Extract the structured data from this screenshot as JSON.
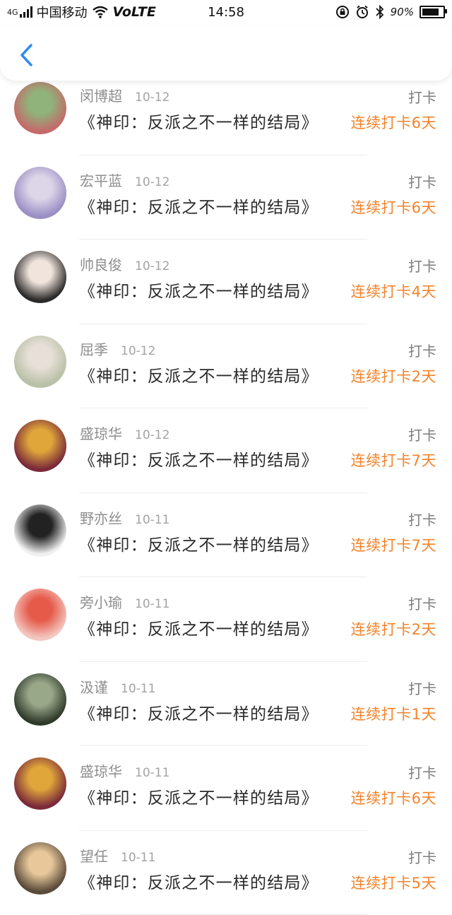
{
  "status_bar": {
    "network": "4G",
    "carrier": "中国移动",
    "volte": "VoLTE",
    "time": "14:58",
    "battery": "90%",
    "battery_level": 0.9
  },
  "header": {
    "back_icon": "chevron-left-icon",
    "accent_color": "#2f8cf0"
  },
  "list": {
    "items": [
      {
        "name": "闵博超",
        "date": "10-12",
        "action": "打卡",
        "book": "《神印：反派之不一样的结局》",
        "streak": "连续打卡6天",
        "avatar_colors": [
          "#c46a6a",
          "#8fb37a"
        ]
      },
      {
        "name": "宏平蓝",
        "date": "10-12",
        "action": "打卡",
        "book": "《神印：反派之不一样的结局》",
        "streak": "连续打卡6天",
        "avatar_colors": [
          "#9a8fc4",
          "#dcd6e8"
        ]
      },
      {
        "name": "帅良俊",
        "date": "10-12",
        "action": "打卡",
        "book": "《神印：反派之不一样的结局》",
        "streak": "连续打卡4天",
        "avatar_colors": [
          "#2a2a2a",
          "#f1e4dc"
        ]
      },
      {
        "name": "屈季",
        "date": "10-12",
        "action": "打卡",
        "book": "《神印：反派之不一样的结局》",
        "streak": "连续打卡2天",
        "avatar_colors": [
          "#b8c0a6",
          "#e8e0d8"
        ]
      },
      {
        "name": "盛琼华",
        "date": "10-12",
        "action": "打卡",
        "book": "《神印：反派之不一样的结局》",
        "streak": "连续打卡7天",
        "avatar_colors": [
          "#7a2a3a",
          "#e0a63a"
        ]
      },
      {
        "name": "野亦丝",
        "date": "10-11",
        "action": "打卡",
        "book": "《神印：反派之不一样的结局》",
        "streak": "连续打卡7天",
        "avatar_colors": [
          "#f0f0f0",
          "#222222"
        ]
      },
      {
        "name": "旁小瑜",
        "date": "10-11",
        "action": "打卡",
        "book": "《神印：反派之不一样的结局》",
        "streak": "连续打卡2天",
        "avatar_colors": [
          "#f3c6c0",
          "#e65a4a"
        ]
      },
      {
        "name": "汲谨",
        "date": "10-11",
        "action": "打卡",
        "book": "《神印：反派之不一样的结局》",
        "streak": "连续打卡1天",
        "avatar_colors": [
          "#2f3a2a",
          "#9aa88a"
        ]
      },
      {
        "name": "盛琼华",
        "date": "10-11",
        "action": "打卡",
        "book": "《神印：反派之不一样的结局》",
        "streak": "连续打卡6天",
        "avatar_colors": [
          "#7a2a3a",
          "#e0a63a"
        ]
      },
      {
        "name": "望任",
        "date": "10-11",
        "action": "打卡",
        "book": "《神印：反派之不一样的结局》",
        "streak": "连续打卡5天",
        "avatar_colors": [
          "#5a4a3a",
          "#e8c89a"
        ]
      }
    ]
  }
}
